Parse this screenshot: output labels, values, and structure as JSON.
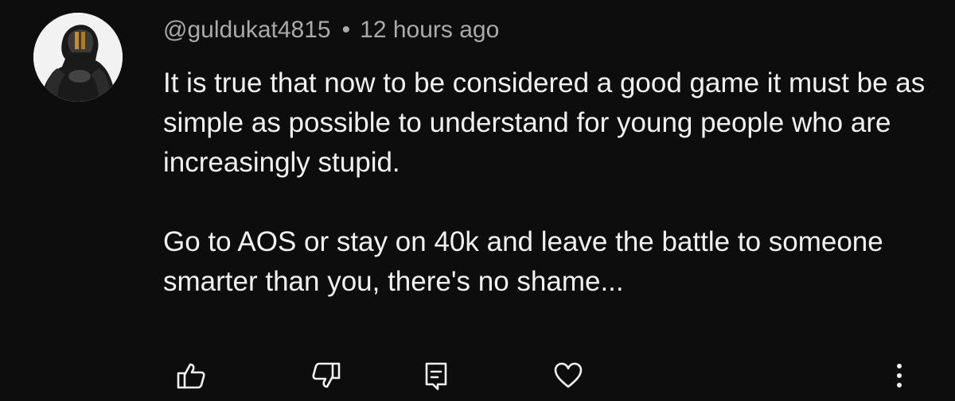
{
  "comment": {
    "author": "@guldukat4815",
    "separator": "•",
    "timestamp": "12 hours ago",
    "paragraphs": [
      "It is true that now to be considered a good game it must be as simple as possible to understand for young people who are increasingly stupid.",
      "Go to AOS or stay on 40k and leave the battle to someone smarter than you, there's no shame..."
    ]
  },
  "actions": {
    "like_icon": "thumbs-up-icon",
    "dislike_icon": "thumbs-down-icon",
    "reply_icon": "reply-comment-icon",
    "heart_icon": "heart-icon",
    "more_icon": "more-vertical-icon"
  },
  "colors": {
    "background": "#0d0d0d",
    "text_primary": "#f1f1f1",
    "text_secondary": "#aaaaaa"
  }
}
